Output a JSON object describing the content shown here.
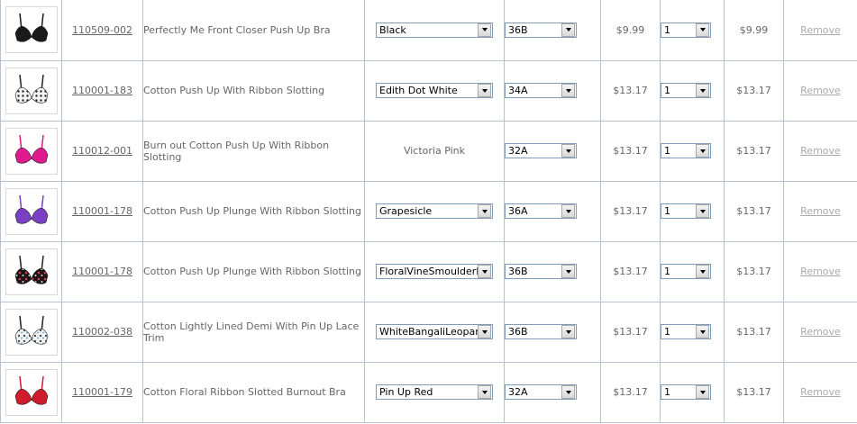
{
  "cart": {
    "remove_label": "Remove",
    "rows": [
      {
        "sku": "110509-002",
        "name": "Perfectly Me Front Closer Push Up Bra",
        "color": "Black",
        "color_is_select": true,
        "size": "36B",
        "price": "$9.99",
        "qty": "1",
        "total": "$9.99",
        "swatch": "#1a1a1a",
        "pattern": "solid-black"
      },
      {
        "sku": "110001-183",
        "name": "Cotton Push Up With Ribbon Slotting",
        "color": "Edith Dot White",
        "color_is_select": true,
        "size": "34A",
        "price": "$13.17",
        "qty": "1",
        "total": "$13.17",
        "swatch": "#f2f2f2",
        "pattern": "dots"
      },
      {
        "sku": "110012-001",
        "name": "Burn out Cotton Push Up With Ribbon Slotting",
        "color": "Victoria Pink",
        "color_is_select": false,
        "size": "32A",
        "price": "$13.17",
        "qty": "1",
        "total": "$13.17",
        "swatch": "#e0198c",
        "pattern": "solid"
      },
      {
        "sku": "110001-178",
        "name": "Cotton Push Up Plunge With Ribbon Slotting",
        "color": "Grapesicle",
        "color_is_select": true,
        "size": "36A",
        "price": "$13.17",
        "qty": "1",
        "total": "$13.17",
        "swatch": "#7a3fc4",
        "pattern": "solid"
      },
      {
        "sku": "110001-178",
        "name": "Cotton Push Up Plunge With Ribbon Slotting",
        "color": "FloralVineSmoulderBl",
        "color_is_select": true,
        "size": "36B",
        "price": "$13.17",
        "qty": "1",
        "total": "$13.17",
        "swatch": "#2a1a1a",
        "pattern": "floral"
      },
      {
        "sku": "110002-038",
        "name": "Cotton Lightly Lined Demi With Pin Up Lace Trim",
        "color": "WhiteBangaliLeopard",
        "color_is_select": true,
        "size": "36B",
        "price": "$13.17",
        "qty": "1",
        "total": "$13.17",
        "swatch": "#e8e8ea",
        "pattern": "leopard"
      },
      {
        "sku": "110001-179",
        "name": "Cotton Floral Ribbon Slotted Burnout Bra",
        "color": "Pin Up Red",
        "color_is_select": true,
        "size": "32A",
        "price": "$13.17",
        "qty": "1",
        "total": "$13.17",
        "swatch": "#d01c2a",
        "pattern": "solid"
      }
    ]
  }
}
